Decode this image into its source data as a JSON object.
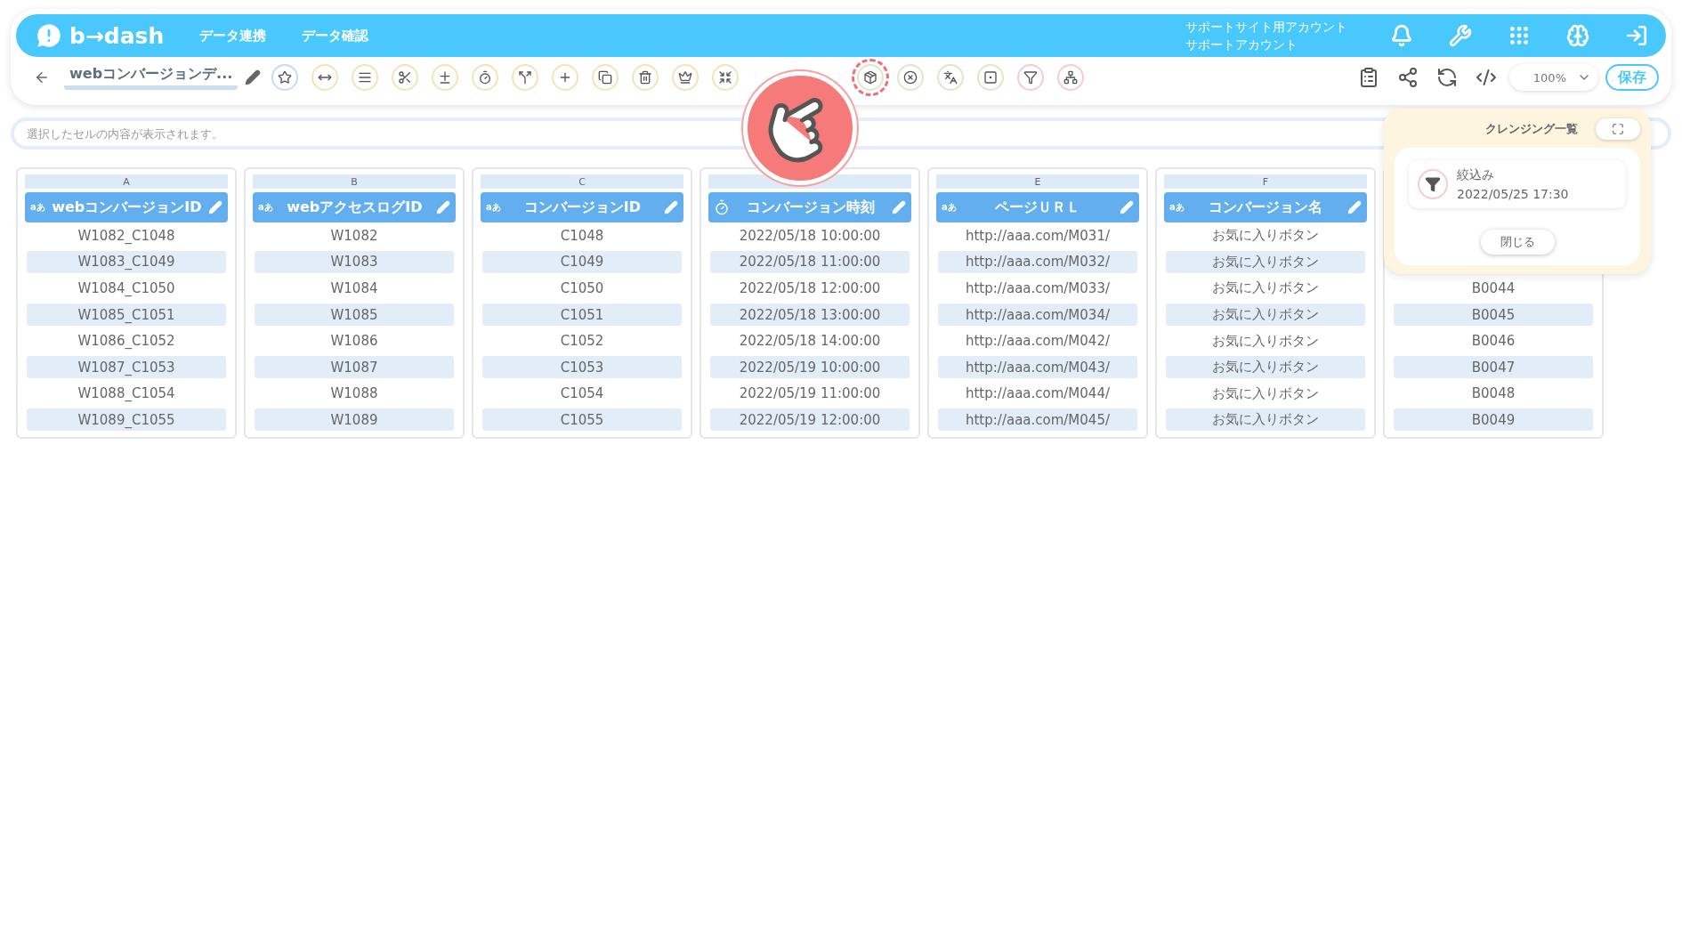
{
  "header": {
    "logo": "b→dash",
    "nav": [
      {
        "label": "データ連携"
      },
      {
        "label": "データ確認"
      }
    ],
    "account": {
      "line1": "サポートサイト用アカウント",
      "line2": "サポートアカウント"
    },
    "icons": [
      {
        "kind": "bell"
      },
      {
        "kind": "wrench"
      },
      {
        "kind": "grid"
      },
      {
        "kind": "brain"
      },
      {
        "kind": "logout"
      }
    ]
  },
  "toolbar": {
    "title": "webコンバージョンデ...",
    "tools": [
      {
        "kind": "star",
        "color": "#c7dbef",
        "highlighted": false
      },
      {
        "kind": "widen",
        "color": "#f3e3b5",
        "highlighted": false
      },
      {
        "kind": "list",
        "color": "#f3e3b5",
        "highlighted": false
      },
      {
        "kind": "scissors",
        "color": "#f3e3b5",
        "highlighted": false
      },
      {
        "kind": "math",
        "color": "#f3e3b5",
        "highlighted": false
      },
      {
        "kind": "timer",
        "color": "#f3e3b5",
        "highlighted": false
      },
      {
        "kind": "split",
        "color": "#f3e3b5",
        "highlighted": false
      },
      {
        "kind": "plus",
        "color": "#f3e3b5",
        "highlighted": false
      },
      {
        "kind": "copy",
        "color": "#f3e3b5",
        "highlighted": false
      },
      {
        "kind": "trash",
        "color": "#f3e3b5",
        "highlighted": false
      },
      {
        "kind": "crown",
        "color": "#f3e3b5",
        "highlighted": false
      },
      {
        "kind": "shrink",
        "color": "#f3e3b5",
        "highlighted": false
      },
      {
        "kind": "gap"
      },
      {
        "kind": "package",
        "color": "#dfe6c9",
        "highlighted": true
      },
      {
        "kind": "x-circle",
        "color": "#dfe6c9",
        "highlighted": false
      },
      {
        "kind": "translate",
        "color": "#dfe6c9",
        "highlighted": false
      },
      {
        "kind": "zero",
        "color": "#dfe6c9",
        "highlighted": false
      },
      {
        "kind": "filter",
        "color": "#f7cccc",
        "highlighted": false
      },
      {
        "kind": "network",
        "color": "#f7cccc",
        "highlighted": false
      }
    ],
    "actions": [
      {
        "kind": "clipboard"
      },
      {
        "kind": "share"
      },
      {
        "kind": "refresh"
      },
      {
        "kind": "code"
      }
    ],
    "zoom": "100%",
    "save": "保存"
  },
  "cell_bar": {
    "placeholder": "選択したセルの内容が表示されます。"
  },
  "columns": [
    {
      "letter": "A",
      "header": {
        "kind": "text",
        "type_mark": "aあ",
        "label": "webコンバージョンID"
      },
      "cells": [
        "W1082_C1048",
        "W1083_C1049",
        "W1084_C1050",
        "W1085_C1051",
        "W1086_C1052",
        "W1087_C1053",
        "W1088_C1054",
        "W1089_C1055"
      ]
    },
    {
      "letter": "B",
      "header": {
        "kind": "text",
        "type_mark": "aあ",
        "label": "webアクセスログID"
      },
      "cells": [
        "W1082",
        "W1083",
        "W1084",
        "W1085",
        "W1086",
        "W1087",
        "W1088",
        "W1089"
      ]
    },
    {
      "letter": "C",
      "header": {
        "kind": "text",
        "type_mark": "aあ",
        "label": "コンバージョンID"
      },
      "cells": [
        "C1048",
        "C1049",
        "C1050",
        "C1051",
        "C1052",
        "C1053",
        "C1054",
        "C1055"
      ]
    },
    {
      "header": {
        "kind": "time",
        "label": "コンバージョン時刻"
      },
      "cells": [
        "2022/05/18 10:00:00",
        "2022/05/18 11:00:00",
        "2022/05/18 12:00:00",
        "2022/05/18 13:00:00",
        "2022/05/18 14:00:00",
        "2022/05/19 10:00:00",
        "2022/05/19 11:00:00",
        "2022/05/19 12:00:00"
      ]
    },
    {
      "letter": "E",
      "header": {
        "kind": "text",
        "type_mark": "aあ",
        "label": "ページＵＲＬ"
      },
      "cells": [
        "http://aaa.com/M031/",
        "http://aaa.com/M032/",
        "http://aaa.com/M033/",
        "http://aaa.com/M034/",
        "http://aaa.com/M042/",
        "http://aaa.com/M043/",
        "http://aaa.com/M044/",
        "http://aaa.com/M045/"
      ]
    },
    {
      "letter": "F",
      "header": {
        "kind": "text",
        "type_mark": "aあ",
        "label": "コンバージョン名"
      },
      "cells": [
        "お気に入りボタン",
        "お気に入りボタン",
        "お気に入りボタン",
        "お気に入りボタン",
        "お気に入りボタン",
        "お気に入りボタン",
        "お気に入りボタン",
        "お気に入りボタン"
      ]
    },
    {
      "cells": [
        "",
        "",
        "B0044",
        "B0045",
        "B0046",
        "B0047",
        "B0048",
        "B0049"
      ]
    }
  ],
  "cleansing_panel": {
    "title": "クレンジング一覧",
    "items": [
      {
        "kind": "filter",
        "name": "絞込み",
        "date": "2022/05/25 17:30"
      }
    ],
    "close": "閉じる"
  }
}
